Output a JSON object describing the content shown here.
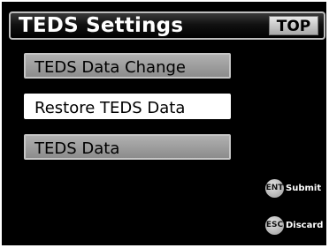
{
  "header": {
    "title": "TEDS Settings",
    "top_label": "TOP"
  },
  "menu": {
    "items": [
      {
        "label": "TEDS Data Change",
        "selected": false
      },
      {
        "label": "Restore TEDS Data",
        "selected": true
      },
      {
        "label": "TEDS Data",
        "selected": false
      }
    ]
  },
  "footer": {
    "ent_key": "ENT",
    "ent_label": "Submit",
    "esc_key": "ESC",
    "esc_label": "Discard"
  }
}
